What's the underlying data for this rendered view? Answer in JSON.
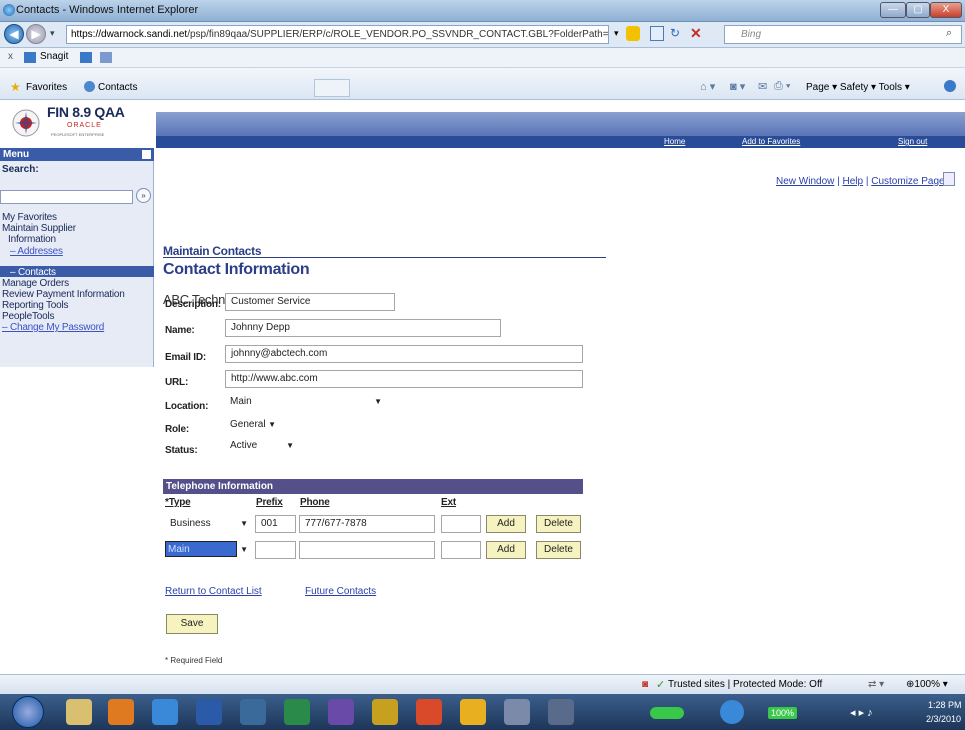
{
  "window": {
    "title": "Contacts - Windows Internet Explorer",
    "minimize": "—",
    "maximize": "▢",
    "close": "X"
  },
  "address": {
    "url_host": "https://dwarnock.sandi.net",
    "url_path": "/psp/fin89qaa/SUPPLIER/ERP/c/ROLE_VENDOR.PO_SSVNDR_CONTACT.GBL?FolderPath=PORTAL_ROOT_OBJECT.",
    "search_placeholder": "Bing"
  },
  "toolbar": {
    "close_x": "x",
    "snagit": "Snagit"
  },
  "favorites": {
    "label": "Favorites",
    "tab": "Contacts",
    "commands": "Page ▾   Safety ▾   Tools ▾"
  },
  "branding": {
    "title": "FIN 8.9 QAA",
    "oracle": "ORACLE",
    "tagline": "PEOPLESOFT ENTERPRISE"
  },
  "portal_nav": {
    "home": "Home",
    "add_favorites": "Add to Favorites",
    "sign_out": "Sign out"
  },
  "menu": {
    "title": "Menu",
    "search_label": "Search:",
    "items": [
      {
        "label": "My Favorites"
      },
      {
        "label": "Maintain Supplier"
      },
      {
        "label": "Information"
      },
      {
        "label": "– Addresses"
      },
      {
        "label": "– Contacts"
      },
      {
        "label": "Manage Orders"
      },
      {
        "label": "Review Payment Information"
      },
      {
        "label": "Reporting Tools"
      },
      {
        "label": "PeopleTools"
      },
      {
        "label": "– Change My Password"
      }
    ]
  },
  "toplinks": {
    "new_window": "New Window",
    "help": "Help",
    "customize": "Customize Page"
  },
  "page": {
    "breadcrumb": "Maintain Contacts",
    "title": "Contact Information",
    "company": "ABC Technologies",
    "fields": {
      "description_label": "Description:",
      "description": "Customer Service",
      "name_label": "Name:",
      "name": "Johnny Depp",
      "email_label": "Email ID:",
      "email": "johnny@abctech.com",
      "url_label": "URL:",
      "url": "http://www.abc.com",
      "location_label": "Location:",
      "location": "Main",
      "role_label": "Role:",
      "role": "General",
      "status_label": "Status:",
      "status": "Active"
    },
    "telephone": {
      "header": "Telephone Information",
      "columns": {
        "type": "*Type",
        "prefix": "Prefix",
        "phone": "Phone",
        "ext": "Ext"
      },
      "rows": [
        {
          "type": "Business",
          "prefix": "001",
          "phone": "777/677-7878",
          "ext": "",
          "add": "Add",
          "delete": "Delete"
        },
        {
          "type": "Main",
          "prefix": "",
          "phone": "",
          "ext": "",
          "add": "Add",
          "delete": "Delete"
        }
      ]
    },
    "links": {
      "return": "Return to Contact List",
      "future": "Future Contacts"
    },
    "save": "Save",
    "required": "* Required Field"
  },
  "status": {
    "zone": "Trusted sites | Protected Mode: Off",
    "zoom": "100%"
  },
  "taskbar": {
    "time": "1:28 PM",
    "date": "2/3/2010",
    "battery": "100%"
  },
  "colors": {
    "brand_blue": "#2b3e86",
    "nav_blue": "#294c98",
    "tel_header": "#55508a",
    "button_yellow": "#f7f3c0"
  }
}
